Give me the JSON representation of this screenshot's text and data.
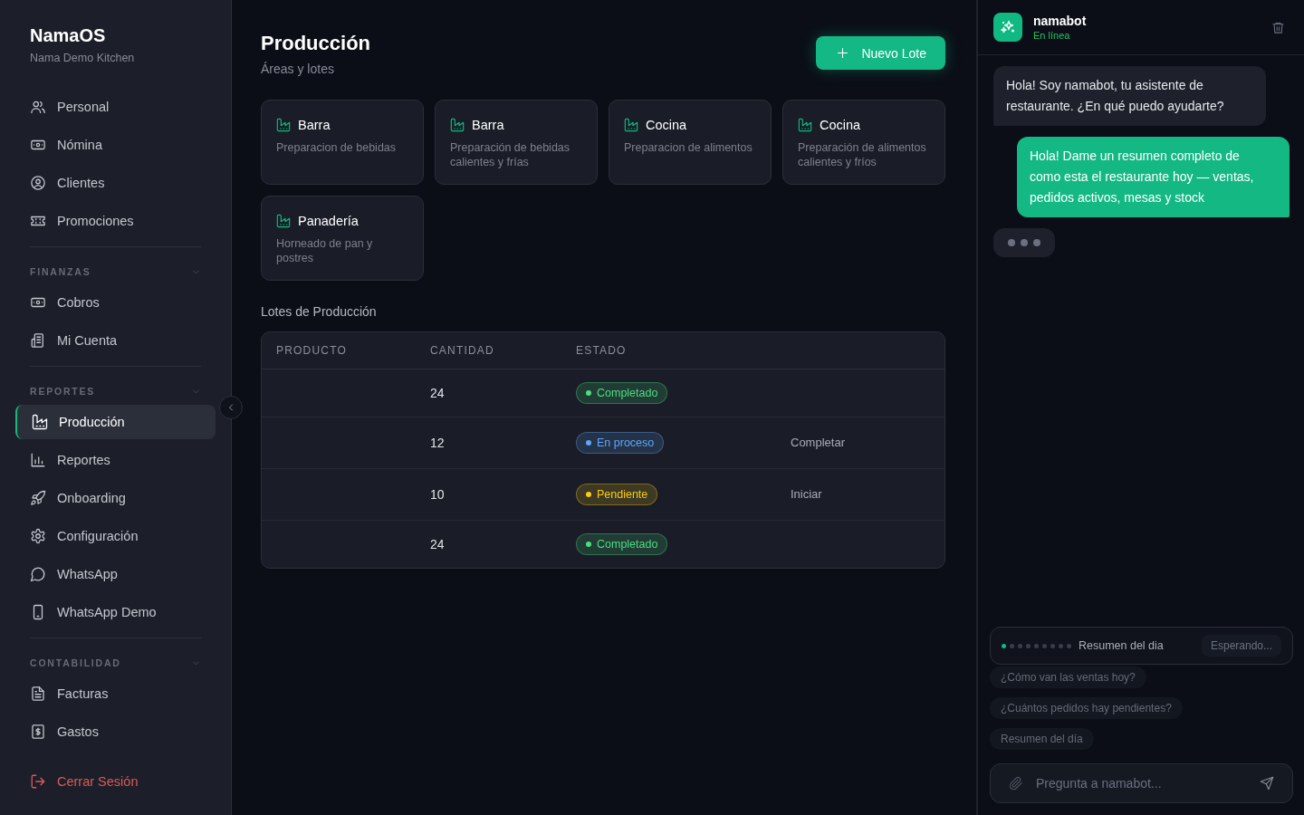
{
  "sidebar": {
    "brand": "NamaOS",
    "subtitle": "Nama Demo Kitchen",
    "groups": [
      {
        "items": [
          {
            "label": "Personal",
            "selected": false
          },
          {
            "label": "Nómina",
            "selected": false
          },
          {
            "label": "Clientes",
            "selected": false
          },
          {
            "label": "Promociones",
            "selected": false
          }
        ]
      },
      {
        "title": "FINANZAS",
        "expanded": true,
        "items": [
          {
            "label": "Cobros",
            "selected": false
          },
          {
            "label": "Mi Cuenta",
            "selected": false
          }
        ]
      },
      {
        "title": "REPORTES",
        "expanded": true,
        "items": [
          {
            "label": "Producción",
            "selected": true
          },
          {
            "label": "Reportes",
            "selected": false
          },
          {
            "label": "Onboarding",
            "selected": false
          },
          {
            "label": "Configuración",
            "selected": false
          },
          {
            "label": "WhatsApp",
            "selected": false
          },
          {
            "label": "WhatsApp Demo",
            "selected": false
          }
        ]
      },
      {
        "title": "CONTABILIDAD",
        "expanded": true,
        "items": [
          {
            "label": "Facturas",
            "selected": false
          },
          {
            "label": "Gastos",
            "selected": false
          }
        ]
      }
    ],
    "logout": "Cerrar Sesión"
  },
  "main": {
    "title": "Producción",
    "subtitle": "Áreas y lotes",
    "new_button": "Nuevo Lote",
    "areas": [
      {
        "title": "Barra",
        "description": "Preparacion de bebidas"
      },
      {
        "title": "Barra",
        "description": "Preparación de bebidas calientes y frías"
      },
      {
        "title": "Cocina",
        "description": "Preparacion de alimentos"
      },
      {
        "title": "Cocina",
        "description": "Preparación de alimentos calientes y fríos"
      },
      {
        "title": "Panadería",
        "description": "Horneado de pan y postres"
      }
    ],
    "batches_title": "Lotes de Producción",
    "table": {
      "columns": [
        "PRODUCTO",
        "CANTIDAD",
        "ESTADO"
      ],
      "rows": [
        {
          "quantity": "24",
          "status": {
            "label": "Completado",
            "color": "#4ade80"
          }
        },
        {
          "quantity": "12",
          "status": {
            "label": "En proceso",
            "color": "#60a5fa"
          },
          "action": "Completar"
        },
        {
          "quantity": "10",
          "status": {
            "label": "Pendiente",
            "color": "#facc15"
          },
          "action": "Iniciar"
        },
        {
          "quantity": "24",
          "status": {
            "label": "Completado",
            "color": "#4ade80"
          }
        }
      ]
    }
  },
  "chat": {
    "name": "namabot",
    "status": "En línea",
    "messages": [
      {
        "kind": "bot",
        "text": "Hola! Soy namabot, tu asistente de restaurante. ¿En qué puedo ayudarte?"
      },
      {
        "kind": "user",
        "text": "Hola! Dame un resumen completo de como esta el restaurante hoy — ventas, pedidos activos, mesas y stock"
      }
    ],
    "typing": true,
    "task": {
      "steps": [
        {
          "done": true
        },
        {
          "done": false
        },
        {
          "done": false
        },
        {
          "done": false
        },
        {
          "done": false
        },
        {
          "done": false
        },
        {
          "done": false
        },
        {
          "done": false
        },
        {
          "done": false
        }
      ],
      "label": "Resumen del dia",
      "status": "Esperando..."
    },
    "suggestions": [
      "¿Cómo van las ventas hoy?",
      "¿Cuántos pedidos hay pendientes?",
      "Resumen del día"
    ],
    "input": {
      "placeholder": "Pregunta a namabot..."
    }
  }
}
